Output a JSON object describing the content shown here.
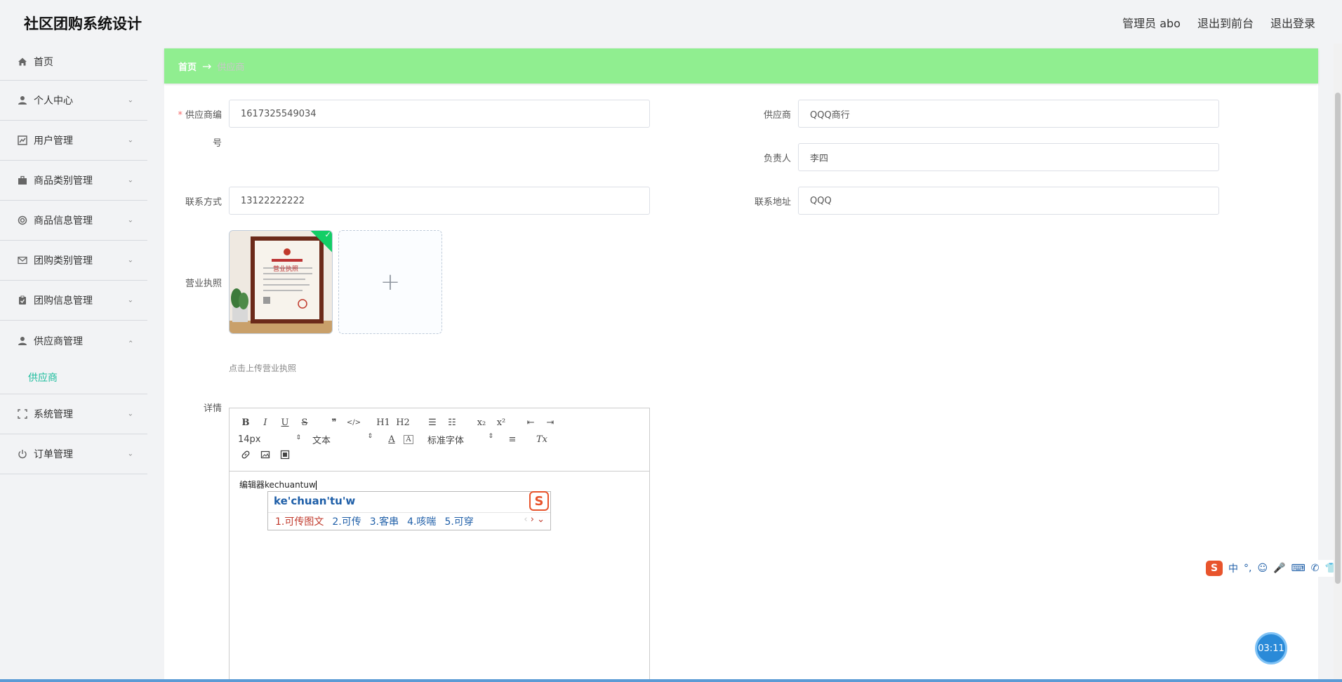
{
  "app": {
    "title": "社区团购系统设计"
  },
  "top_links": {
    "user": "管理员 abo",
    "front": "退出到前台",
    "logout": "退出登录"
  },
  "sidebar": {
    "items": [
      {
        "label": "首页",
        "icon": "home-icon"
      },
      {
        "label": "个人中心",
        "icon": "person-icon"
      },
      {
        "label": "用户管理",
        "icon": "chart-icon"
      },
      {
        "label": "商品类别管理",
        "icon": "briefcase-icon"
      },
      {
        "label": "商品信息管理",
        "icon": "lifebuoy-icon"
      },
      {
        "label": "团购类别管理",
        "icon": "mail-icon"
      },
      {
        "label": "团购信息管理",
        "icon": "clipboard-icon"
      },
      {
        "label": "供应商管理",
        "icon": "person-icon"
      },
      {
        "label": "系统管理",
        "icon": "scan-icon"
      },
      {
        "label": "订单管理",
        "icon": "power-icon"
      }
    ],
    "submenu": {
      "label": "供应商"
    }
  },
  "breadcrumb": {
    "home": "首页",
    "arrow": "→",
    "current": "供应商"
  },
  "form": {
    "supplier_no": {
      "label_a": "供应商编",
      "label_b": "号",
      "value": "1617325549034"
    },
    "supplier": {
      "label": "供应商",
      "value": "QQQ商行"
    },
    "owner": {
      "label": "负责人",
      "value": "李四"
    },
    "phone": {
      "label": "联系方式",
      "value": "13122222222"
    },
    "address": {
      "label": "联系地址",
      "value": "QQQ"
    },
    "license": {
      "label": "营业执照",
      "tip": "点击上传营业执照",
      "add": "+",
      "image_title": "营业执照"
    },
    "detail": {
      "label": "详情"
    }
  },
  "editor": {
    "font_size": "14px",
    "block_type": "文本",
    "font_family": "标准字体",
    "content": "编辑器kechuantuw",
    "toolbar_row1": [
      "B",
      "I",
      "U",
      "S",
      "❞",
      "</>",
      "H1",
      "H2",
      "☰",
      "☷",
      "x₂",
      "x²",
      "⇤",
      "⇥"
    ],
    "toolbar_row2_extra": [
      "A",
      "A",
      "≡",
      "Tx"
    ]
  },
  "ime": {
    "pinyin": "ke'chuan'tu'w",
    "candidates": [
      "1.可传图文",
      "2.可传",
      "3.客串",
      "4.咳喘",
      "5.可穿"
    ],
    "bar": [
      "S",
      "中",
      "°,",
      "☺",
      "🎤",
      "⌨",
      "✆",
      "👕",
      "▦"
    ]
  },
  "timer": {
    "value": "03:11"
  }
}
